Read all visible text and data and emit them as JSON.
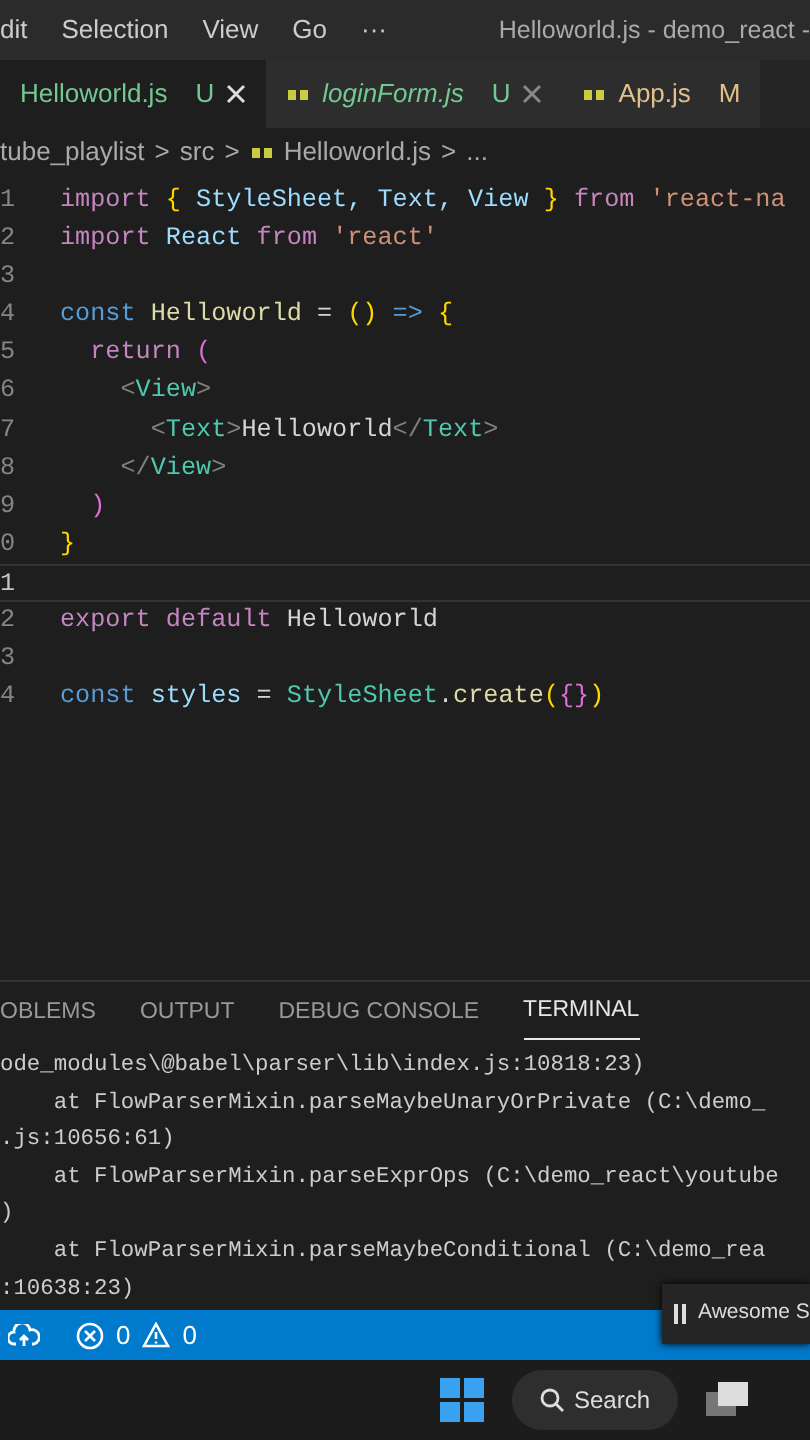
{
  "menu_bar": {
    "items": [
      "dit",
      "Selection",
      "View",
      "Go",
      "···"
    ],
    "title": "Helloworld.js - demo_react -"
  },
  "tabs": [
    {
      "label": "Helloworld.js",
      "status": "U",
      "selected": true,
      "preview": false,
      "file_icon": false,
      "closable": true,
      "color": "#73c991"
    },
    {
      "label": "loginForm.js",
      "status": "U",
      "selected": false,
      "preview": true,
      "file_icon": true,
      "closable": true,
      "color": "#73c991"
    },
    {
      "label": "App.js",
      "status": "M",
      "selected": false,
      "preview": false,
      "file_icon": true,
      "closable": false,
      "color": "#e2c08d"
    }
  ],
  "breadcrumb": [
    {
      "kind": "folder",
      "label": "tube_playlist"
    },
    {
      "kind": "separator",
      "label": ">"
    },
    {
      "kind": "folder",
      "label": "src"
    },
    {
      "kind": "separator",
      "label": ">"
    },
    {
      "kind": "file",
      "label": "Helloworld.js"
    },
    {
      "kind": "separator",
      "label": ">"
    },
    {
      "kind": "folder",
      "label": "..."
    }
  ],
  "code_lines": [
    {
      "number": "1",
      "current": false,
      "tokens": [
        {
          "kind": "control",
          "text": "import "
        },
        {
          "kind": "bracket",
          "text": "{"
        },
        {
          "kind": "variable",
          "text": " StyleSheet, Text, View "
        },
        {
          "kind": "bracket",
          "text": "}"
        },
        {
          "kind": "control",
          "text": " from "
        },
        {
          "kind": "string",
          "text": "'react-na"
        }
      ]
    },
    {
      "number": "2",
      "current": false,
      "tokens": [
        {
          "kind": "control",
          "text": "import"
        },
        {
          "kind": "variable",
          "text": " React "
        },
        {
          "kind": "control",
          "text": "from "
        },
        {
          "kind": "string",
          "text": "'react'"
        }
      ]
    },
    {
      "number": "3",
      "current": false
    },
    {
      "number": "4",
      "current": false,
      "tokens": [
        {
          "kind": "keyword",
          "text": "const "
        },
        {
          "kind": "function",
          "text": "Helloworld"
        },
        {
          "kind": "plain",
          "text": " = "
        },
        {
          "kind": "bracket",
          "text": "()"
        },
        {
          "kind": "keyword",
          "text": " => "
        },
        {
          "kind": "bracket",
          "text": "{"
        }
      ]
    },
    {
      "number": "5",
      "current": false,
      "tokens": [
        {
          "kind": "control",
          "text": "  return "
        },
        {
          "kind": "bracket2",
          "text": "("
        }
      ]
    },
    {
      "number": "6",
      "current": false,
      "tokens": [
        {
          "kind": "tagpunct",
          "text": "    <"
        },
        {
          "kind": "tag",
          "text": "View"
        },
        {
          "kind": "tagpunct",
          "text": ">"
        }
      ]
    },
    {
      "number": "7",
      "current": false,
      "tokens": [
        {
          "kind": "tagpunct",
          "text": "      <"
        },
        {
          "kind": "tag",
          "text": "Text"
        },
        {
          "kind": "tagpunct",
          "text": ">"
        },
        {
          "kind": "plain",
          "text": "Helloworld"
        },
        {
          "kind": "tagpunct",
          "text": "</"
        },
        {
          "kind": "tag",
          "text": "Text"
        },
        {
          "kind": "tagpunct",
          "text": ">"
        }
      ]
    },
    {
      "number": "8",
      "current": false,
      "tokens": [
        {
          "kind": "tagpunct",
          "text": "    </"
        },
        {
          "kind": "tag",
          "text": "View"
        },
        {
          "kind": "tagpunct",
          "text": ">"
        }
      ]
    },
    {
      "number": "9",
      "current": false,
      "tokens": [
        {
          "kind": "bracket2",
          "text": "  )"
        }
      ]
    },
    {
      "number": "0",
      "current": false,
      "tokens": [
        {
          "kind": "bracket",
          "text": "}"
        }
      ]
    },
    {
      "number": "1",
      "current": true
    },
    {
      "number": "2",
      "current": false,
      "tokens": [
        {
          "kind": "control",
          "text": "export default"
        },
        {
          "kind": "plain",
          "text": " Helloworld"
        }
      ]
    },
    {
      "number": "3",
      "current": false
    },
    {
      "number": "4",
      "current": false,
      "tokens": [
        {
          "kind": "keyword",
          "text": "const "
        },
        {
          "kind": "variable",
          "text": "styles"
        },
        {
          "kind": "plain",
          "text": " = "
        },
        {
          "kind": "class",
          "text": "StyleSheet"
        },
        {
          "kind": "plain",
          "text": "."
        },
        {
          "kind": "function",
          "text": "create"
        },
        {
          "kind": "bracket",
          "text": "("
        },
        {
          "kind": "bracket2",
          "text": "{}"
        },
        {
          "kind": "bracket",
          "text": ")"
        }
      ]
    }
  ],
  "panel_tabs": [
    {
      "label": "OBLEMS",
      "selected": false
    },
    {
      "label": "OUTPUT",
      "selected": false
    },
    {
      "label": "DEBUG CONSOLE",
      "selected": false
    },
    {
      "label": "TERMINAL",
      "selected": true
    }
  ],
  "terminal_lines": [
    "ode_modules\\@babel\\parser\\lib\\index.js:10818:23)",
    "    at FlowParserMixin.parseMaybeUnaryOrPrivate (C:\\demo_",
    ".js:10656:61)",
    "    at FlowParserMixin.parseExprOps (C:\\demo_react\\youtube",
    ")",
    "    at FlowParserMixin.parseMaybeConditional (C:\\demo_rea",
    ":10638:23)"
  ],
  "status_bar": {
    "errors": "0",
    "warnings": "0"
  },
  "notification": {
    "text": "Awesome S"
  },
  "taskbar": {
    "search": "Search"
  }
}
